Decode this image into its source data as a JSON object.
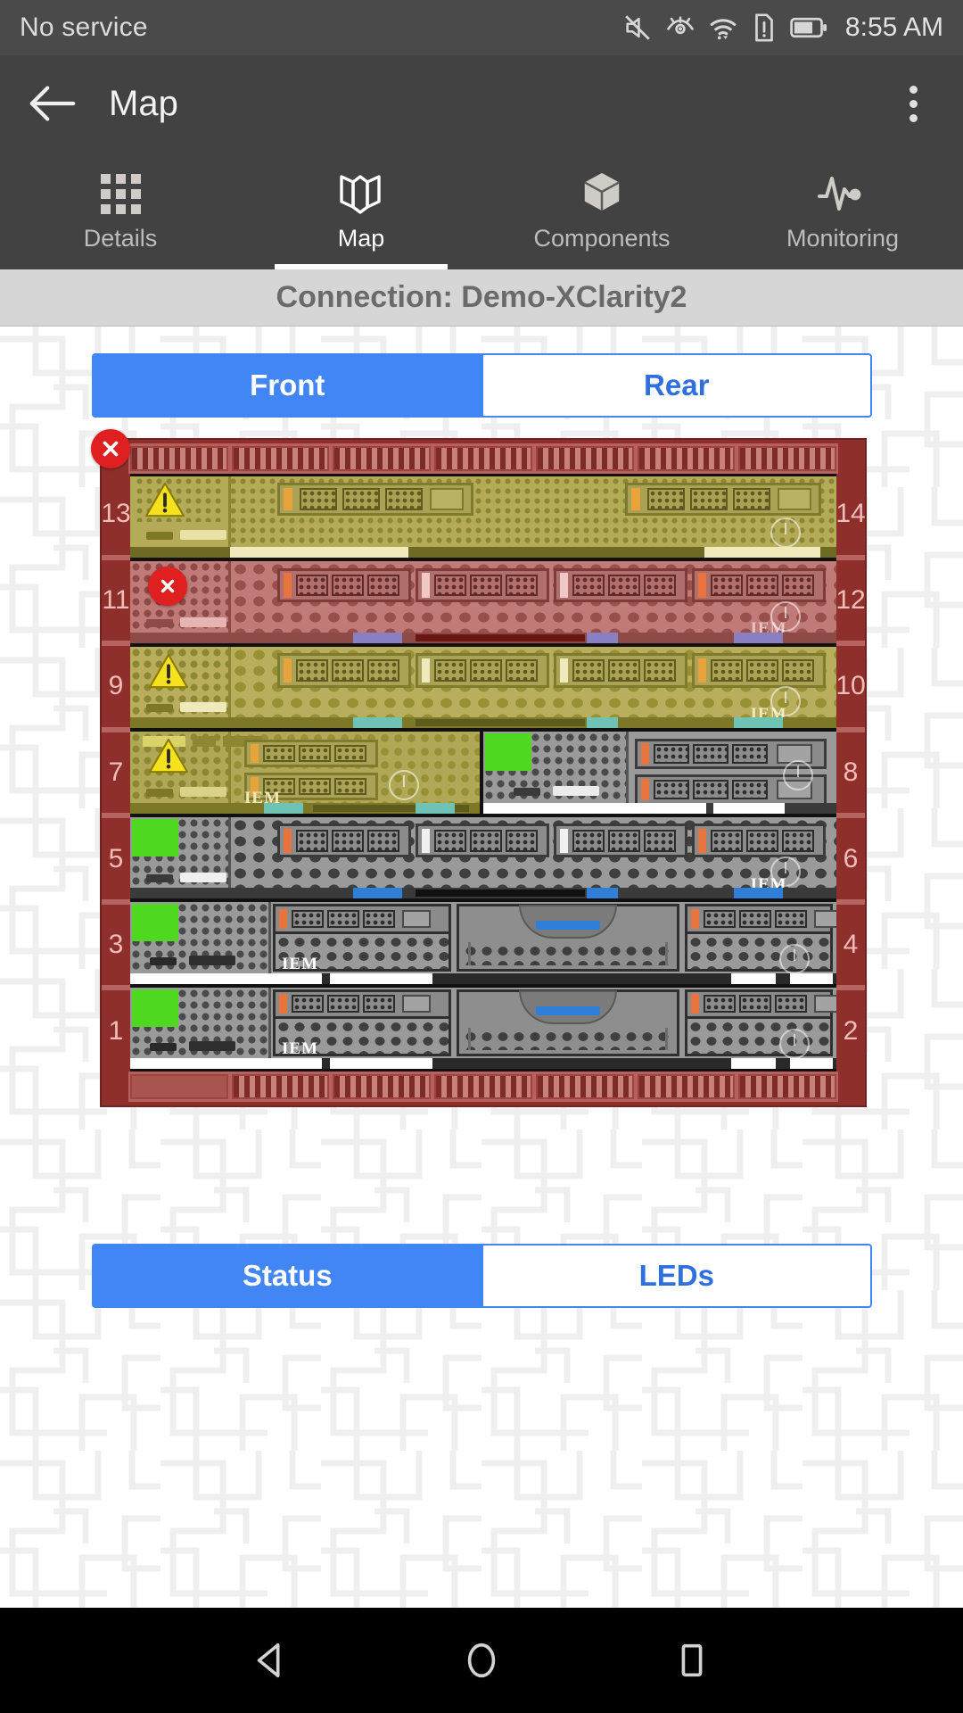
{
  "status_bar": {
    "carrier": "No service",
    "time": "8:55 AM",
    "icons": [
      "mute-icon",
      "eye-icon",
      "wifi-icon",
      "sim-alert-icon",
      "battery-icon"
    ]
  },
  "app_bar": {
    "back_icon": "back-arrow-icon",
    "title": "Map",
    "overflow_icon": "overflow-menu-icon"
  },
  "tabs": [
    {
      "label": "Details",
      "icon": "grid-icon",
      "active": false
    },
    {
      "label": "Map",
      "icon": "map-icon",
      "active": true
    },
    {
      "label": "Components",
      "icon": "cube-icon",
      "active": false
    },
    {
      "label": "Monitoring",
      "icon": "pulse-icon",
      "active": false
    }
  ],
  "connection_bar": {
    "text": "Connection: Demo-XClarity2"
  },
  "view_toggle": {
    "options": [
      {
        "label": "Front",
        "selected": true
      },
      {
        "label": "Rear",
        "selected": false
      }
    ]
  },
  "legend_toggle": {
    "options": [
      {
        "label": "Status",
        "selected": true
      },
      {
        "label": "LEDs",
        "selected": false
      }
    ]
  },
  "rack": {
    "chassis_status": "critical",
    "chassis_badge_icon": "error-x-icon",
    "colors": {
      "critical": "#c26e6e",
      "warning": "#b8b05a",
      "normal": "#9e9e9e",
      "rack_frame": "#8f2f2b",
      "error_red": "#e02020",
      "warning_yellow": "#f5e11e",
      "green_led": "#4fd820"
    },
    "left_unit_labels": [
      "13",
      "11",
      "9",
      "7",
      "5",
      "3",
      "1"
    ],
    "right_unit_labels": [
      "14",
      "12",
      "10",
      "8",
      "6",
      "4",
      "2"
    ],
    "rows": [
      {
        "u_left": "13",
        "u_right": "14",
        "status": "warning",
        "badge": "warning-triangle-icon",
        "type": "compute-node-wide",
        "label": "",
        "drive_groups": 2
      },
      {
        "u_left": "11",
        "u_right": "12",
        "status": "critical",
        "badge": "error-x-icon",
        "type": "compute-node",
        "label": "IEM",
        "drive_groups": 4
      },
      {
        "u_left": "9",
        "u_right": "10",
        "status": "warning",
        "badge": "warning-triangle-icon",
        "type": "compute-node",
        "label": "IEM",
        "drive_groups": 4
      },
      {
        "u_left": "7",
        "u_right": "8",
        "status": "warning",
        "badge": "warning-triangle-icon",
        "type": "split-half",
        "label": "IEM",
        "drive_groups": 2
      },
      {
        "u_left": "5",
        "u_right": "6",
        "status": "normal",
        "badge": "green-led",
        "type": "compute-node",
        "label": "IEM",
        "drive_groups": 4
      },
      {
        "u_left": "3",
        "u_right": "4",
        "status": "normal",
        "badge": "green-led",
        "type": "storage-node",
        "label": "IEM",
        "drive_groups": 3
      },
      {
        "u_left": "1",
        "u_right": "2",
        "status": "normal",
        "badge": "green-led",
        "type": "storage-node",
        "label": "IEM",
        "drive_groups": 3
      }
    ]
  },
  "nav_bar": {
    "buttons": [
      {
        "name": "back-nav-button",
        "icon": "triangle-back-icon"
      },
      {
        "name": "home-nav-button",
        "icon": "circle-home-icon"
      },
      {
        "name": "recents-nav-button",
        "icon": "square-recents-icon"
      }
    ]
  }
}
